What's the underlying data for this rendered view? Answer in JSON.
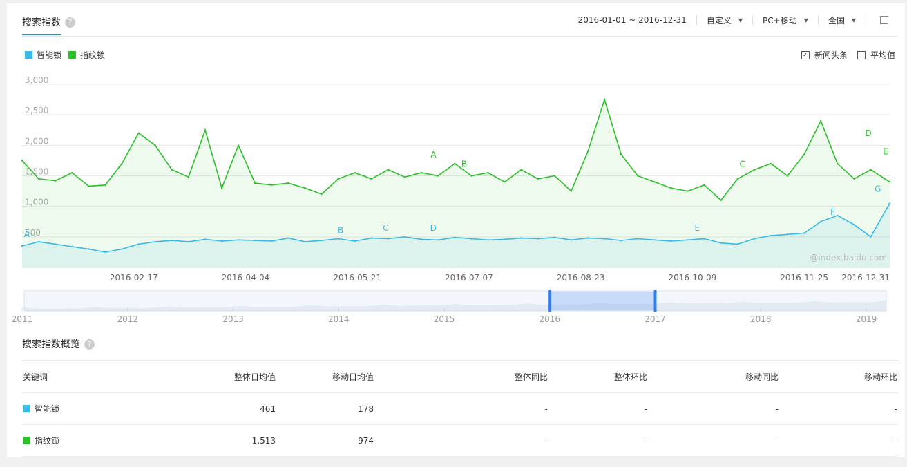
{
  "header": {
    "tab_title": "搜索指数",
    "help_glyph": "?",
    "date_range": "2016-01-01 ~ 2016-12-31",
    "custom_label": "自定义",
    "device_label": "PC+移动",
    "region_label": "全国"
  },
  "legend": {
    "items": [
      {
        "label": "智能锁",
        "color": "#3ab9e6"
      },
      {
        "label": "指纹锁",
        "color": "#2bbf28"
      }
    ]
  },
  "toggles": {
    "news_label": "新闻头条",
    "news_checked": "✓",
    "avg_label": "平均值"
  },
  "watermark": "@index.baidu.com",
  "chart_data": {
    "type": "line",
    "ylim": [
      0,
      3000
    ],
    "yticks": [
      "3,000",
      "2,500",
      "2,000",
      "1,500",
      "1,000",
      "500"
    ],
    "xticks": [
      "2016-02-17",
      "2016-04-04",
      "2016-05-21",
      "2016-07-07",
      "2016-08-23",
      "2016-10-09",
      "2016-11-25",
      "2016-12-31"
    ],
    "series": [
      {
        "name": "指纹锁",
        "color": "#2bbf28",
        "x": [
          "2016-01-01",
          "2016-01-08",
          "2016-01-15",
          "2016-01-22",
          "2016-01-29",
          "2016-02-05",
          "2016-02-12",
          "2016-02-19",
          "2016-02-26",
          "2016-03-04",
          "2016-03-11",
          "2016-03-18",
          "2016-03-25",
          "2016-04-01",
          "2016-04-08",
          "2016-04-15",
          "2016-04-22",
          "2016-04-29",
          "2016-05-06",
          "2016-05-13",
          "2016-05-20",
          "2016-05-27",
          "2016-06-03",
          "2016-06-10",
          "2016-06-17",
          "2016-06-24",
          "2016-07-01",
          "2016-07-08",
          "2016-07-15",
          "2016-07-22",
          "2016-07-29",
          "2016-08-05",
          "2016-08-12",
          "2016-08-19",
          "2016-08-26",
          "2016-09-02",
          "2016-09-09",
          "2016-09-16",
          "2016-09-23",
          "2016-09-30",
          "2016-10-07",
          "2016-10-14",
          "2016-10-21",
          "2016-10-28",
          "2016-11-04",
          "2016-11-11",
          "2016-11-18",
          "2016-11-25",
          "2016-12-02",
          "2016-12-09",
          "2016-12-16",
          "2016-12-23",
          "2016-12-31"
        ],
        "y": [
          1750,
          1450,
          1420,
          1550,
          1330,
          1350,
          1700,
          2200,
          2000,
          1600,
          1480,
          2250,
          1300,
          2000,
          1380,
          1350,
          1380,
          1300,
          1200,
          1450,
          1550,
          1450,
          1600,
          1480,
          1550,
          1500,
          1700,
          1500,
          1550,
          1400,
          1600,
          1450,
          1500,
          1250,
          1900,
          2750,
          1850,
          1500,
          1400,
          1300,
          1250,
          1350,
          1100,
          1450,
          1600,
          1700,
          1500,
          1850,
          2400,
          1700,
          1450,
          1600,
          1400
        ]
      },
      {
        "name": "智能锁",
        "color": "#3ab9e6",
        "x": [
          "2016-01-01",
          "2016-01-08",
          "2016-01-15",
          "2016-01-22",
          "2016-01-29",
          "2016-02-05",
          "2016-02-12",
          "2016-02-19",
          "2016-02-26",
          "2016-03-04",
          "2016-03-11",
          "2016-03-18",
          "2016-03-25",
          "2016-04-01",
          "2016-04-08",
          "2016-04-15",
          "2016-04-22",
          "2016-04-29",
          "2016-05-06",
          "2016-05-13",
          "2016-05-20",
          "2016-05-27",
          "2016-06-03",
          "2016-06-10",
          "2016-06-17",
          "2016-06-24",
          "2016-07-01",
          "2016-07-08",
          "2016-07-15",
          "2016-07-22",
          "2016-07-29",
          "2016-08-05",
          "2016-08-12",
          "2016-08-19",
          "2016-08-26",
          "2016-09-02",
          "2016-09-09",
          "2016-09-16",
          "2016-09-23",
          "2016-09-30",
          "2016-10-07",
          "2016-10-14",
          "2016-10-21",
          "2016-10-28",
          "2016-11-04",
          "2016-11-11",
          "2016-11-18",
          "2016-11-25",
          "2016-12-02",
          "2016-12-09",
          "2016-12-16",
          "2016-12-23",
          "2016-12-31"
        ],
        "y": [
          350,
          420,
          380,
          340,
          300,
          250,
          300,
          380,
          420,
          440,
          420,
          460,
          430,
          450,
          440,
          430,
          480,
          420,
          440,
          470,
          430,
          480,
          470,
          500,
          460,
          450,
          490,
          470,
          450,
          460,
          480,
          470,
          490,
          450,
          480,
          470,
          440,
          470,
          450,
          430,
          450,
          470,
          400,
          380,
          470,
          520,
          540,
          560,
          750,
          850,
          700,
          500,
          1050
        ]
      }
    ],
    "annotations": [
      {
        "series": "指纹锁",
        "label": "A",
        "x": "2016-06-22",
        "y": 1800
      },
      {
        "series": "指纹锁",
        "label": "B",
        "x": "2016-07-05",
        "y": 1650
      },
      {
        "series": "指纹锁",
        "label": "C",
        "x": "2016-10-30",
        "y": 1650
      },
      {
        "series": "指纹锁",
        "label": "D",
        "x": "2016-12-22",
        "y": 2150
      },
      {
        "series": "指纹锁",
        "label": "E",
        "x": "2016-12-31",
        "y": 1850
      },
      {
        "series": "智能锁",
        "label": "A",
        "x": "2016-01-03",
        "y": 500
      },
      {
        "series": "智能锁",
        "label": "B",
        "x": "2016-05-14",
        "y": 560
      },
      {
        "series": "智能锁",
        "label": "C",
        "x": "2016-06-02",
        "y": 600
      },
      {
        "series": "智能锁",
        "label": "D",
        "x": "2016-06-22",
        "y": 600
      },
      {
        "series": "智能锁",
        "label": "E",
        "x": "2016-10-11",
        "y": 600
      },
      {
        "series": "智能锁",
        "label": "F",
        "x": "2016-12-07",
        "y": 860
      },
      {
        "series": "智能锁",
        "label": "G",
        "x": "2016-12-26",
        "y": 1240
      }
    ],
    "navigator": {
      "years": [
        "2011",
        "2012",
        "2013",
        "2014",
        "2015",
        "2016",
        "2017",
        "2018",
        "2019"
      ],
      "selected": [
        "2016-01-01",
        "2016-12-31"
      ]
    }
  },
  "summary": {
    "title": "搜索指数概览",
    "columns": [
      "关键词",
      "整体日均值",
      "移动日均值",
      "整体同比",
      "整体环比",
      "移动同比",
      "移动环比"
    ],
    "rows": [
      {
        "keyword": "智能锁",
        "color": "#3ab9e6",
        "overall": "461",
        "mobile": "178",
        "yoy": "-",
        "mom": "-",
        "m_yoy": "-",
        "m_mom": "-"
      },
      {
        "keyword": "指纹锁",
        "color": "#2bbf28",
        "overall": "1,513",
        "mobile": "974",
        "yoy": "-",
        "mom": "-",
        "m_yoy": "-",
        "m_mom": "-"
      }
    ]
  }
}
